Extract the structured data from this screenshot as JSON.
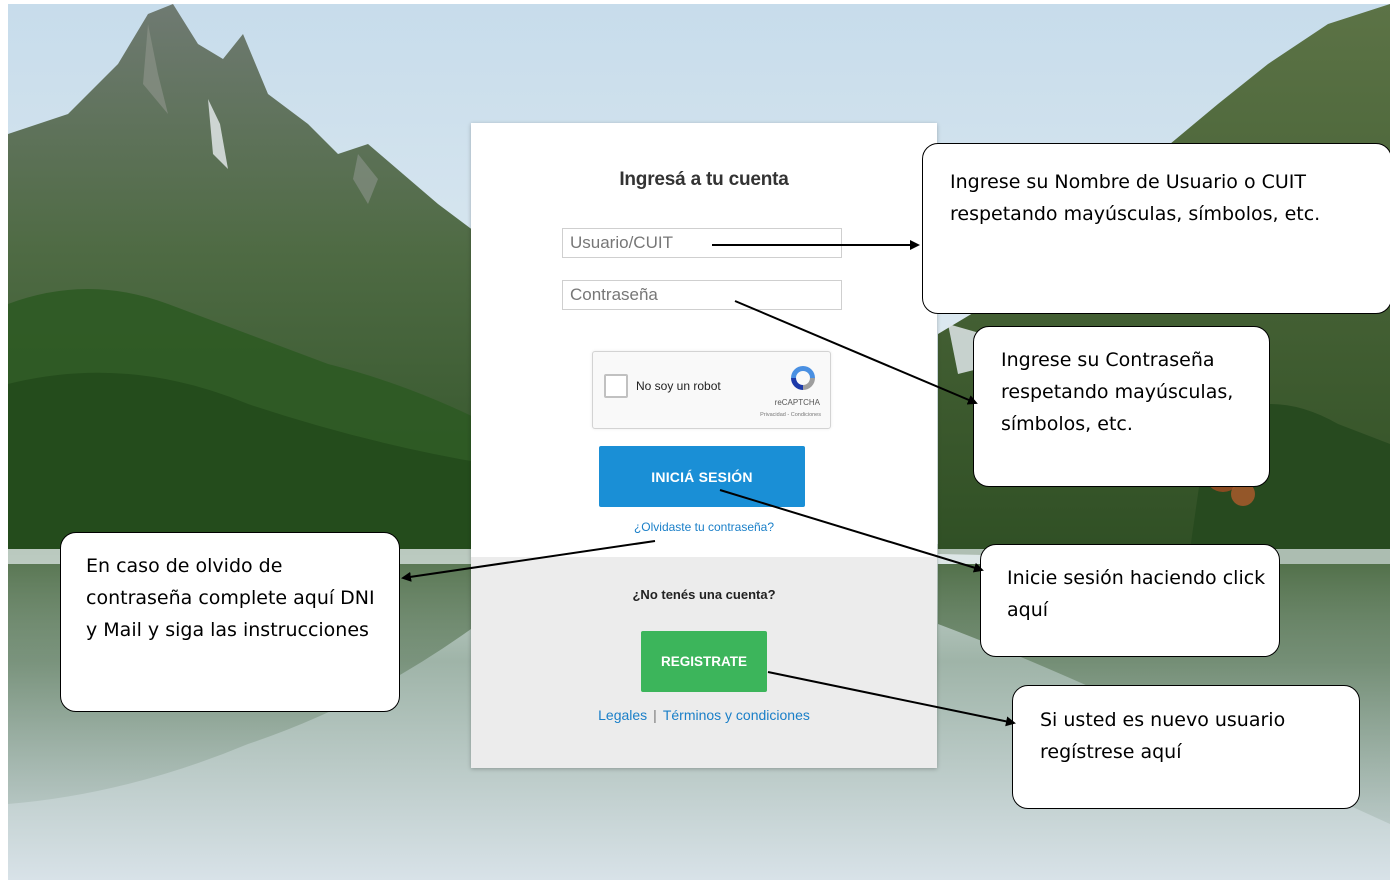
{
  "login": {
    "title": "Ingresá a tu cuenta",
    "username_placeholder": "Usuario/CUIT",
    "password_placeholder": "Contraseña",
    "captcha_label": "No soy un robot",
    "captcha_brand": "reCAPTCHA",
    "captcha_links": "Privacidad - Condiciones",
    "login_button": "INICIÁ SESIÓN",
    "forgot_link": "¿Olvidaste tu contraseña?",
    "no_account": "¿No tenés una cuenta?",
    "register_button": "REGISTRATE",
    "legal_link": "Legales",
    "separator": "|",
    "terms_link": "Términos y condiciones"
  },
  "callouts": {
    "user": "Ingrese su Nombre de Usuario o CUIT respetando mayúsculas, símbolos, etc.",
    "password": "Ingrese su Contraseña respetando mayúsculas, símbolos, etc.",
    "login": "Inicie sesión haciendo click aquí",
    "register": "Si usted es nuevo usuario regístrese  aquí",
    "forgot": "En caso de olvido de contraseña complete aquí DNI y Mail y siga las instrucciones"
  },
  "colors": {
    "login_button": "#1a8fd6",
    "register_button": "#3cb55b",
    "link": "#1a7fc8"
  },
  "icons": {
    "recaptcha": "recaptcha-logo-icon"
  }
}
